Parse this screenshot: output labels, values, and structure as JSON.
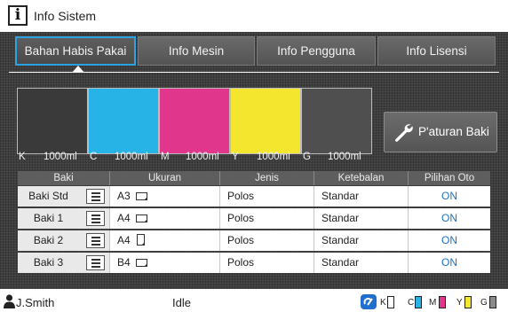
{
  "window": {
    "title": "Info Sistem"
  },
  "tabs": [
    {
      "label": "Bahan Habis Pakai",
      "active": true
    },
    {
      "label": "Info Mesin",
      "active": false
    },
    {
      "label": "Info Pengguna",
      "active": false
    },
    {
      "label": "Info Lisensi",
      "active": false
    }
  ],
  "inks": [
    {
      "code": "K",
      "volume": "1000ml",
      "color": "#3a3a3a"
    },
    {
      "code": "C",
      "volume": "1000ml",
      "color": "#27b3e6"
    },
    {
      "code": "M",
      "volume": "1000ml",
      "color": "#e0368c"
    },
    {
      "code": "Y",
      "volume": "1000ml",
      "color": "#f4e52f"
    },
    {
      "code": "G",
      "volume": "1000ml",
      "color": "#4f4f4f"
    }
  ],
  "tray_settings_button": {
    "label": "P'aturan Baki",
    "icon": "wrench-icon"
  },
  "table": {
    "headers": [
      "Baki",
      "Ukuran",
      "Jenis",
      "Ketebalan",
      "Pilihan Oto"
    ],
    "rows": [
      {
        "tray": "Baki Std",
        "size": "A3",
        "orientation": "landscape",
        "type": "Polos",
        "thickness": "Standar",
        "auto": "ON"
      },
      {
        "tray": "Baki 1",
        "size": "A4",
        "orientation": "landscape",
        "type": "Polos",
        "thickness": "Standar",
        "auto": "ON"
      },
      {
        "tray": "Baki 2",
        "size": "A4",
        "orientation": "portrait",
        "type": "Polos",
        "thickness": "Standar",
        "auto": "ON"
      },
      {
        "tray": "Baki 3",
        "size": "B4",
        "orientation": "landscape",
        "type": "Polos",
        "thickness": "Standar",
        "auto": "ON"
      }
    ]
  },
  "status": {
    "user": "J.Smith",
    "state": "Idle",
    "ink_labels": [
      "K",
      "C",
      "M",
      "Y",
      "G"
    ],
    "ink_colors": [
      "#ffffff",
      "#27b3e6",
      "#e0368c",
      "#f4e52f",
      "#8a8a8a"
    ]
  },
  "colors": {
    "accent": "#2aa3e0",
    "on_text": "#1a72c4"
  }
}
